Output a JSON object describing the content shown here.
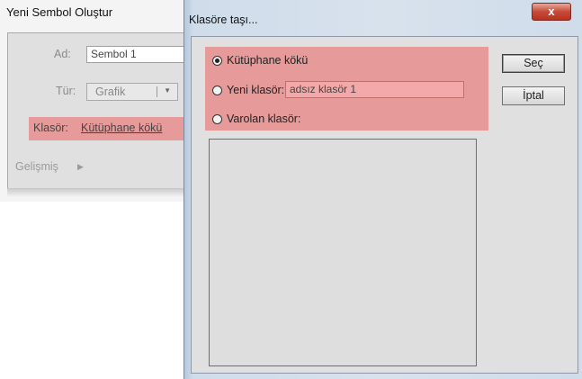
{
  "new_symbol_dialog": {
    "title": "Yeni Sembol Oluştur",
    "name_label": "Ad:",
    "name_value": "Sembol 1",
    "type_label": "Tür:",
    "type_value": "Grafik",
    "folder_label": "Klasör:",
    "folder_link": "Kütüphane kökü",
    "advanced_label": "Gelişmiş"
  },
  "move_dialog": {
    "title": "Klasöre taşı...",
    "close_glyph": "x",
    "options": {
      "library_root": "Kütüphane kökü",
      "new_folder": "Yeni klasör:",
      "new_folder_value": "adsız klasör 1",
      "existing_folder": "Varolan klasör:"
    },
    "selected_option": "library_root",
    "buttons": {
      "select": "Seç",
      "cancel": "İptal"
    }
  },
  "colors": {
    "highlight": "#e69a9a",
    "close_button": "#c74a38"
  }
}
